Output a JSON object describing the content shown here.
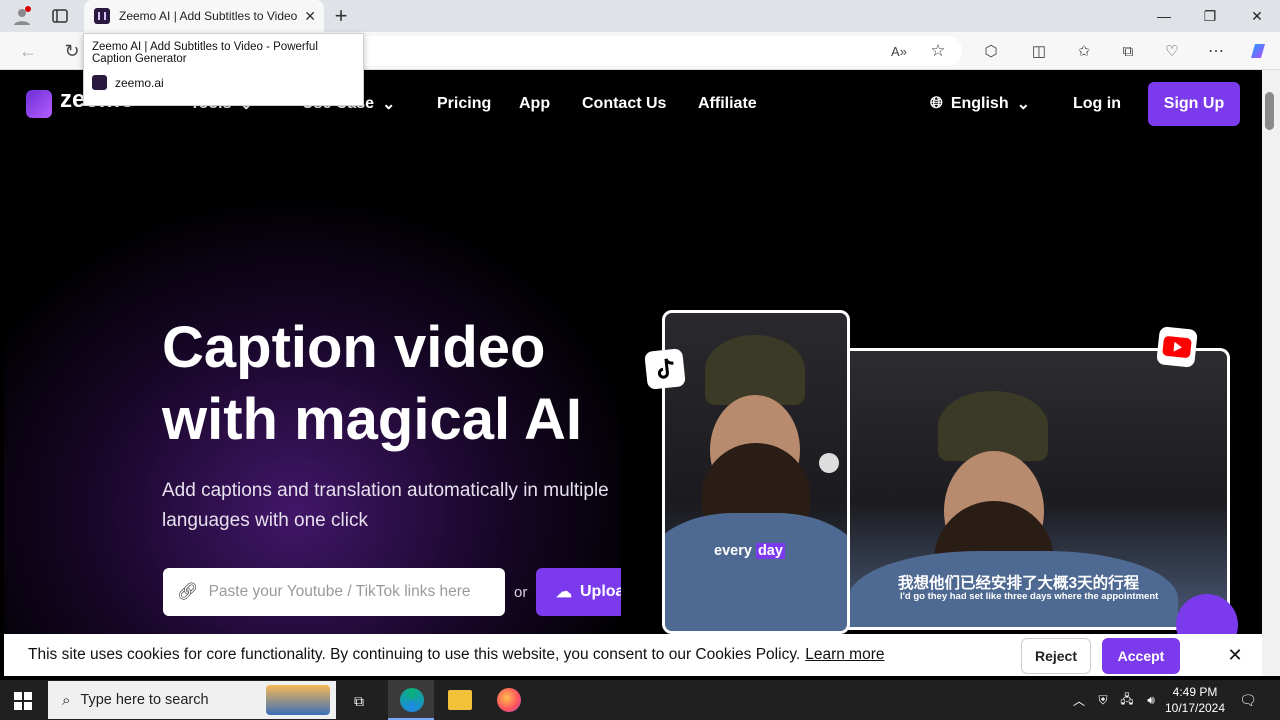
{
  "browser": {
    "tab_title": "Zeemo AI | Add Subtitles to Video",
    "tooltip_title": "Zeemo AI | Add Subtitles to Video - Powerful Caption Generator",
    "tooltip_domain": "zeemo.ai",
    "new_tab": "+"
  },
  "nav": {
    "logo": "zeemo",
    "tools": "Tools",
    "use_case": "Use Case",
    "pricing": "Pricing",
    "app": "App",
    "contact": "Contact Us",
    "affiliate": "Affiliate",
    "language": "English",
    "login": "Log in",
    "signup": "Sign Up"
  },
  "hero": {
    "title_line1": "Caption video",
    "title_line2": "with magical AI",
    "subtitle": "Add captions and translation automatically in multiple languages with one click",
    "input_placeholder": "Paste your Youtube / TikTok links here",
    "or": "or",
    "upload": "Upload"
  },
  "preview": {
    "caption_en_a": "every ",
    "caption_en_b": "day",
    "caption_zh": "我想他们已经安排了大概3天的行程",
    "caption_en2": "I'd go they had set like three days where the appointment"
  },
  "cookie": {
    "text": "This site uses cookies for core functionality. By continuing to use this website, you consent to our Cookies Policy.",
    "learn_more": "Learn more",
    "reject": "Reject",
    "accept": "Accept"
  },
  "taskbar": {
    "search": "Type here to search",
    "time": "4:49 PM",
    "date": "10/17/2024"
  },
  "colors": {
    "brand": "#7c3aed"
  }
}
